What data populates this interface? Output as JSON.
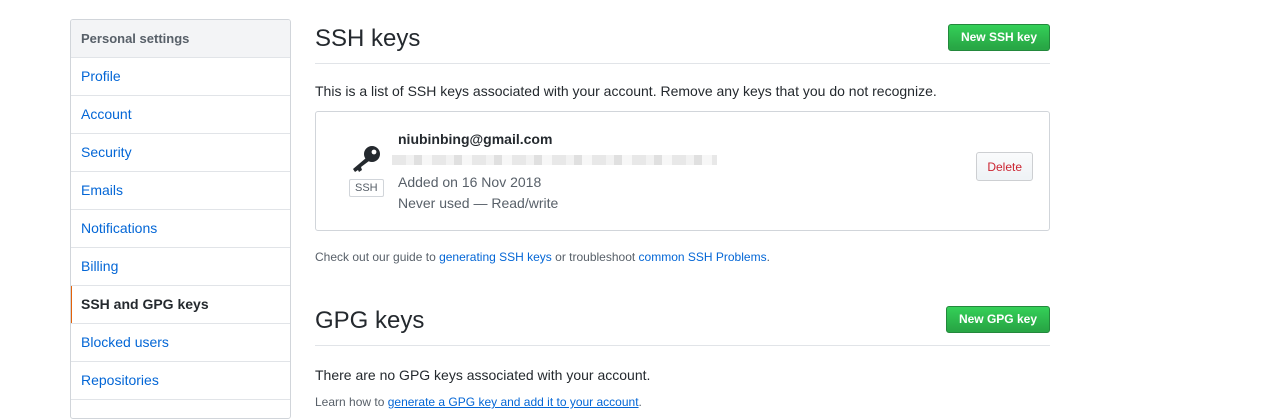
{
  "sidebar": {
    "header": "Personal settings",
    "items": [
      {
        "label": "Profile"
      },
      {
        "label": "Account"
      },
      {
        "label": "Security"
      },
      {
        "label": "Emails"
      },
      {
        "label": "Notifications"
      },
      {
        "label": "Billing"
      },
      {
        "label": "SSH and GPG keys",
        "selected": true
      },
      {
        "label": "Blocked users"
      },
      {
        "label": "Repositories"
      }
    ]
  },
  "ssh": {
    "title": "SSH keys",
    "new_button": "New SSH key",
    "description": "This is a list of SSH keys associated with your account. Remove any keys that you do not recognize.",
    "key": {
      "title": "niubinbing@gmail.com",
      "badge": "SSH",
      "added": "Added on 16 Nov 2018",
      "usage": "Never used — Read/write",
      "delete_button": "Delete"
    },
    "note": {
      "prefix": "Check out our guide to ",
      "link1": "generating SSH keys",
      "middle": " or troubleshoot ",
      "link2": "common SSH Problems",
      "suffix": "."
    }
  },
  "gpg": {
    "title": "GPG keys",
    "new_button": "New GPG key",
    "description": "There are no GPG keys associated with your account.",
    "note": {
      "prefix": "Learn how to ",
      "link": "generate a GPG key and add it to your account",
      "suffix": "."
    }
  },
  "colors": {
    "accent_green": "#28a745",
    "link_blue": "#0366d6",
    "selected_marker": "#e36209",
    "danger_red": "#cb2431"
  }
}
